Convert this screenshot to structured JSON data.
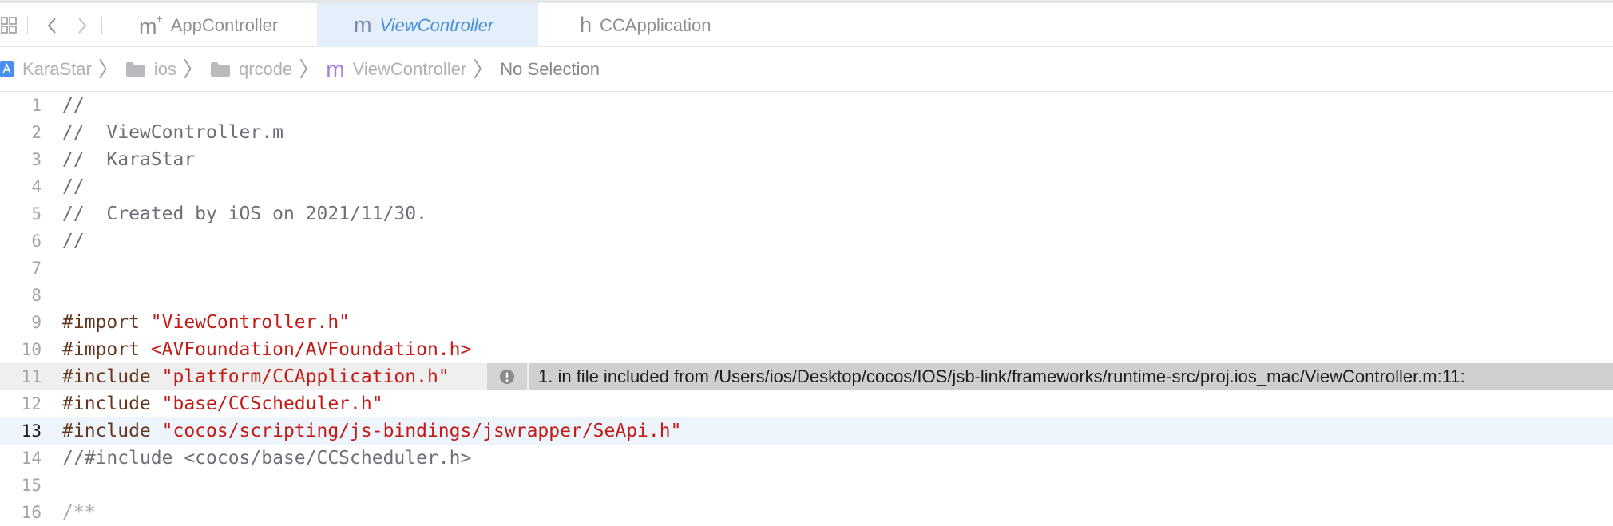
{
  "tabs": [
    {
      "label": "AppController",
      "glyph": "m",
      "glyph_suffix": "+",
      "active": false
    },
    {
      "label": "ViewController",
      "glyph": "m",
      "glyph_suffix": "",
      "active": true
    },
    {
      "label": "CCApplication",
      "glyph": "h",
      "glyph_suffix": "",
      "active": false
    }
  ],
  "nav": {
    "back_icon": "chevron-left-icon",
    "forward_icon": "chevron-right-icon",
    "grid_icon": "related-items-grid-icon"
  },
  "breadcrumb": [
    {
      "label": "KaraStar",
      "icon": "app-project-icon"
    },
    {
      "label": "ios",
      "icon": "folder-icon"
    },
    {
      "label": "qrcode",
      "icon": "folder-icon"
    },
    {
      "label": "ViewController",
      "icon": "objc-m-file-icon"
    },
    {
      "label": "No Selection",
      "icon": ""
    }
  ],
  "editor": {
    "current_line": 13,
    "lines": [
      {
        "n": "1",
        "parts": [
          {
            "t": "//",
            "c": "comment"
          }
        ]
      },
      {
        "n": "2",
        "parts": [
          {
            "t": "//  ViewController.m",
            "c": "comment"
          }
        ]
      },
      {
        "n": "3",
        "parts": [
          {
            "t": "//  KaraStar",
            "c": "comment"
          }
        ]
      },
      {
        "n": "4",
        "parts": [
          {
            "t": "//",
            "c": "comment"
          }
        ]
      },
      {
        "n": "5",
        "parts": [
          {
            "t": "//  Created by iOS on 2021/11/30.",
            "c": "comment"
          }
        ]
      },
      {
        "n": "6",
        "parts": [
          {
            "t": "//",
            "c": "comment"
          }
        ]
      },
      {
        "n": "7",
        "parts": []
      },
      {
        "n": "8",
        "parts": []
      },
      {
        "n": "9",
        "parts": [
          {
            "t": "#import ",
            "c": "directive"
          },
          {
            "t": "\"ViewController.h\"",
            "c": "string"
          }
        ]
      },
      {
        "n": "10",
        "parts": [
          {
            "t": "#import ",
            "c": "directive"
          },
          {
            "t": "<AVFoundation/AVFoundation.h>",
            "c": "string"
          }
        ]
      },
      {
        "n": "11",
        "parts": [
          {
            "t": "#include ",
            "c": "directive"
          },
          {
            "t": "\"platform/CCApplication.h\"",
            "c": "string"
          }
        ]
      },
      {
        "n": "12",
        "parts": [
          {
            "t": "#include ",
            "c": "directive"
          },
          {
            "t": "\"base/CCScheduler.h\"",
            "c": "string"
          }
        ]
      },
      {
        "n": "13",
        "parts": [
          {
            "t": "#include ",
            "c": "directive"
          },
          {
            "t": "\"cocos/scripting/js-bindings/jswrapper/SeApi.h\"",
            "c": "string"
          }
        ]
      },
      {
        "n": "14",
        "parts": [
          {
            "t": "//#include <cocos/base/CCScheduler.h>",
            "c": "comment"
          }
        ]
      },
      {
        "n": "15",
        "parts": []
      },
      {
        "n": "16",
        "parts": [
          {
            "t": "/**",
            "c": "doc"
          }
        ]
      }
    ]
  },
  "issue": {
    "line": 11,
    "icon": "exclamation-circle-icon",
    "message": "1. in file included from /Users/ios/Desktop/cocos/IOS/jsb-link/frameworks/runtime-src/proj.ios_mac/ViewController.m:11:"
  }
}
